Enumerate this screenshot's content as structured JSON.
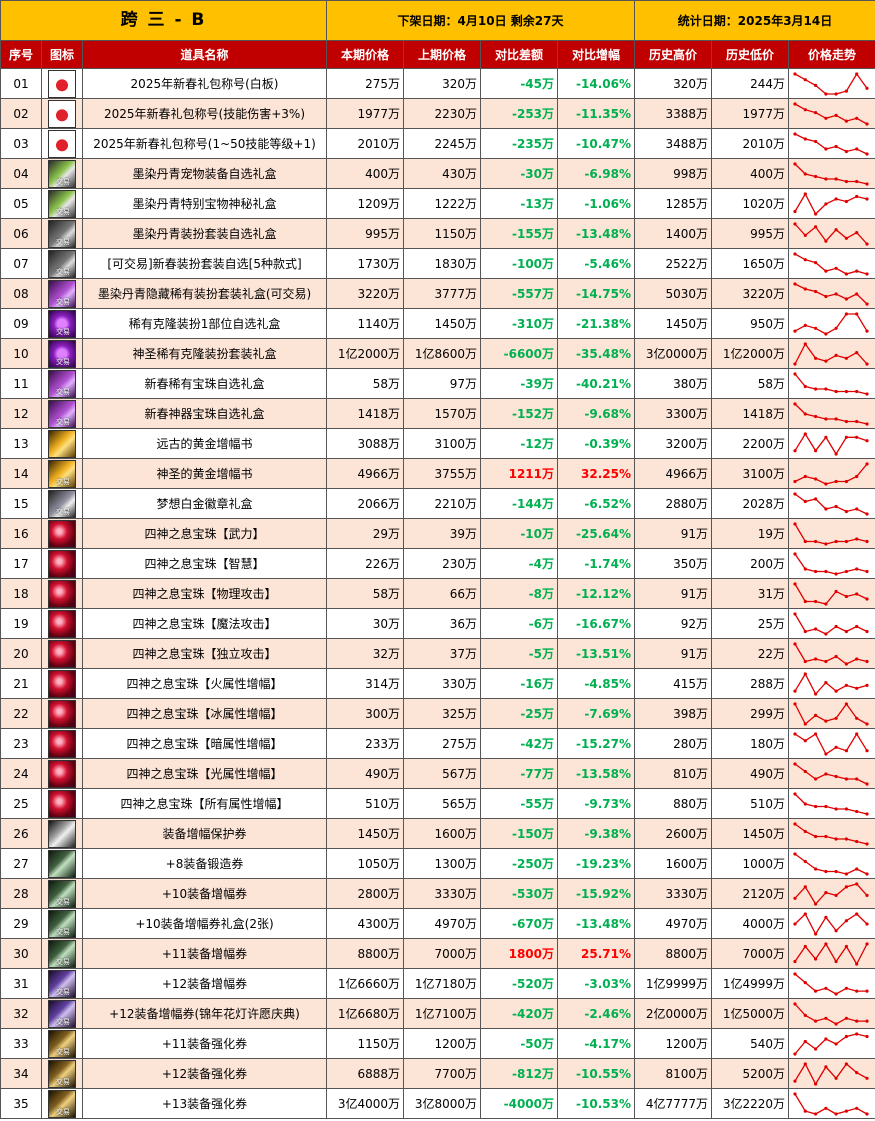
{
  "title": {
    "server": "跨 三 - B",
    "removal": "下架日期：4月10日  剩余27天",
    "stat_date": "统计日期：2025年3月14日"
  },
  "headers": [
    "序号",
    "图标",
    "道具名称",
    "本期价格",
    "上期价格",
    "对比差额",
    "对比增幅",
    "历史高价",
    "历史低价",
    "价格走势"
  ],
  "colors": {
    "header_bg": "#c00000",
    "title_bg": "#ffc000",
    "alt_row": "#fce4d6",
    "decrease": "#00b050",
    "increase": "#ff0000",
    "trend_line": "#e00000"
  },
  "rows": [
    {
      "idx": "01",
      "icon": "red-envelope-icon",
      "trade": "",
      "name": "2025年新春礼包称号(白板)",
      "cur": "275万",
      "prev": "320万",
      "diff": "-45万",
      "pct": "-14.06%",
      "high": "320万",
      "low": "244万",
      "trend": [
        9,
        7,
        5,
        2,
        2,
        3,
        9,
        4
      ],
      "up": false
    },
    {
      "idx": "02",
      "icon": "red-envelope-icon",
      "trade": "",
      "name": "2025年新春礼包称号(技能伤害+3%)",
      "cur": "1977万",
      "prev": "2230万",
      "diff": "-253万",
      "pct": "-11.35%",
      "high": "3388万",
      "low": "1977万",
      "trend": [
        9,
        7,
        6,
        4,
        5,
        3,
        4,
        2
      ],
      "up": false
    },
    {
      "idx": "03",
      "icon": "red-envelope-icon",
      "trade": "",
      "name": "2025年新春礼包称号(1~50技能等级+1)",
      "cur": "2010万",
      "prev": "2245万",
      "diff": "-235万",
      "pct": "-10.47%",
      "high": "3488万",
      "low": "2010万",
      "trend": [
        9,
        7,
        6,
        3,
        4,
        2,
        3,
        1
      ],
      "up": false
    },
    {
      "idx": "04",
      "icon": "gift-box-green-icon",
      "trade": "交易",
      "name": "墨染丹青宠物装备自选礼盒",
      "cur": "400万",
      "prev": "430万",
      "diff": "-30万",
      "pct": "-6.98%",
      "high": "998万",
      "low": "400万",
      "trend": [
        9,
        5,
        4,
        3,
        3,
        2,
        2,
        1
      ],
      "up": false
    },
    {
      "idx": "05",
      "icon": "gift-box-green-icon",
      "trade": "交易",
      "name": "墨染丹青特别宝物神秘礼盒",
      "cur": "1209万",
      "prev": "1222万",
      "diff": "-13万",
      "pct": "-1.06%",
      "high": "1285万",
      "low": "1020万",
      "trend": [
        2,
        9,
        1,
        5,
        7,
        6,
        8,
        7
      ],
      "up": false
    },
    {
      "idx": "06",
      "icon": "gift-box-dark-icon",
      "trade": "交易",
      "name": "墨染丹青装扮套装自选礼盒",
      "cur": "995万",
      "prev": "1150万",
      "diff": "-155万",
      "pct": "-13.48%",
      "high": "1400万",
      "low": "995万",
      "trend": [
        9,
        5,
        8,
        3,
        7,
        4,
        6,
        2
      ],
      "up": false
    },
    {
      "idx": "07",
      "icon": "gift-box-dark-icon",
      "trade": "交易",
      "name": "[可交易]新春装扮套装自选[5种款式]",
      "cur": "1730万",
      "prev": "1830万",
      "diff": "-100万",
      "pct": "-5.46%",
      "high": "2522万",
      "low": "1650万",
      "trend": [
        9,
        7,
        6,
        3,
        4,
        2,
        3,
        2
      ],
      "up": false
    },
    {
      "idx": "08",
      "icon": "gift-box-purple-icon",
      "trade": "交易",
      "name": "墨染丹青隐藏稀有装扮套装礼盒(可交易)",
      "cur": "3220万",
      "prev": "3777万",
      "diff": "-557万",
      "pct": "-14.75%",
      "high": "5030万",
      "low": "3220万",
      "trend": [
        9,
        7,
        6,
        4,
        5,
        3,
        5,
        1
      ],
      "up": false
    },
    {
      "idx": "09",
      "icon": "orb-purple-icon",
      "trade": "交易",
      "name": "稀有克隆装扮1部位自选礼盒",
      "cur": "1140万",
      "prev": "1450万",
      "diff": "-310万",
      "pct": "-21.38%",
      "high": "1450万",
      "low": "950万",
      "trend": [
        3,
        5,
        4,
        2,
        4,
        9,
        9,
        3
      ],
      "up": false
    },
    {
      "idx": "10",
      "icon": "orb-purple-icon",
      "trade": "交易",
      "name": "神圣稀有克隆装扮套装礼盒",
      "cur": "1亿2000万",
      "prev": "1亿8600万",
      "diff": "-6600万",
      "pct": "-35.48%",
      "high": "3亿0000万",
      "low": "1亿2000万",
      "trend": [
        2,
        9,
        4,
        3,
        5,
        4,
        6,
        2
      ],
      "up": false
    },
    {
      "idx": "11",
      "icon": "gift-box-purple-icon",
      "trade": "交易",
      "name": "新春稀有宝珠自选礼盒",
      "cur": "58万",
      "prev": "97万",
      "diff": "-39万",
      "pct": "-40.21%",
      "high": "380万",
      "low": "58万",
      "trend": [
        9,
        4,
        3,
        3,
        2,
        2,
        2,
        1
      ],
      "up": false
    },
    {
      "idx": "12",
      "icon": "gift-box-purple-icon",
      "trade": "交易",
      "name": "新春神器宝珠自选礼盒",
      "cur": "1418万",
      "prev": "1570万",
      "diff": "-152万",
      "pct": "-9.68%",
      "high": "3300万",
      "low": "1418万",
      "trend": [
        9,
        5,
        4,
        3,
        3,
        2,
        2,
        1
      ],
      "up": false
    },
    {
      "idx": "13",
      "icon": "gold-book-icon",
      "trade": "",
      "name": "远古的黄金增幅书",
      "cur": "3088万",
      "prev": "3100万",
      "diff": "-12万",
      "pct": "-0.39%",
      "high": "3200万",
      "low": "2200万",
      "trend": [
        4,
        9,
        4,
        8,
        3,
        8,
        8,
        7
      ],
      "up": false
    },
    {
      "idx": "14",
      "icon": "gold-book-icon",
      "trade": "交易",
      "name": "神圣的黄金增幅书",
      "cur": "4966万",
      "prev": "3755万",
      "diff": "1211万",
      "pct": "32.25%",
      "high": "4966万",
      "low": "3100万",
      "trend": [
        2,
        4,
        3,
        1,
        2,
        2,
        4,
        9
      ],
      "up": true
    },
    {
      "idx": "15",
      "icon": "badge-icon",
      "trade": "交易",
      "name": "梦想白金徽章礼盒",
      "cur": "2066万",
      "prev": "2210万",
      "diff": "-144万",
      "pct": "-6.52%",
      "high": "2880万",
      "low": "2028万",
      "trend": [
        9,
        6,
        7,
        3,
        4,
        2,
        3,
        1
      ],
      "up": false
    },
    {
      "idx": "16",
      "icon": "red-gem-icon",
      "trade": "",
      "name": "四神之息宝珠【武力】",
      "cur": "29万",
      "prev": "39万",
      "diff": "-10万",
      "pct": "-25.64%",
      "high": "91万",
      "low": "19万",
      "trend": [
        9,
        2,
        2,
        1,
        2,
        2,
        3,
        2
      ],
      "up": false
    },
    {
      "idx": "17",
      "icon": "red-gem-icon",
      "trade": "",
      "name": "四神之息宝珠【智慧】",
      "cur": "226万",
      "prev": "230万",
      "diff": "-4万",
      "pct": "-1.74%",
      "high": "350万",
      "low": "200万",
      "trend": [
        9,
        3,
        2,
        2,
        1,
        2,
        3,
        2
      ],
      "up": false
    },
    {
      "idx": "18",
      "icon": "red-gem-icon",
      "trade": "",
      "name": "四神之息宝珠【物理攻击】",
      "cur": "58万",
      "prev": "66万",
      "diff": "-8万",
      "pct": "-12.12%",
      "high": "91万",
      "low": "31万",
      "trend": [
        9,
        2,
        2,
        1,
        6,
        4,
        5,
        3
      ],
      "up": false
    },
    {
      "idx": "19",
      "icon": "red-gem-icon",
      "trade": "",
      "name": "四神之息宝珠【魔法攻击】",
      "cur": "30万",
      "prev": "36万",
      "diff": "-6万",
      "pct": "-16.67%",
      "high": "92万",
      "low": "25万",
      "trend": [
        9,
        2,
        3,
        1,
        4,
        2,
        4,
        2
      ],
      "up": false
    },
    {
      "idx": "20",
      "icon": "red-gem-icon",
      "trade": "",
      "name": "四神之息宝珠【独立攻击】",
      "cur": "32万",
      "prev": "37万",
      "diff": "-5万",
      "pct": "-13.51%",
      "high": "91万",
      "low": "22万",
      "trend": [
        9,
        2,
        3,
        2,
        4,
        1,
        3,
        2
      ],
      "up": false
    },
    {
      "idx": "21",
      "icon": "red-gem-icon",
      "trade": "",
      "name": "四神之息宝珠【火属性增幅】",
      "cur": "314万",
      "prev": "330万",
      "diff": "-16万",
      "pct": "-4.85%",
      "high": "415万",
      "low": "288万",
      "trend": [
        3,
        9,
        2,
        6,
        3,
        5,
        4,
        5
      ],
      "up": false
    },
    {
      "idx": "22",
      "icon": "red-gem-icon",
      "trade": "",
      "name": "四神之息宝珠【冰属性增幅】",
      "cur": "300万",
      "prev": "325万",
      "diff": "-25万",
      "pct": "-7.69%",
      "high": "398万",
      "low": "299万",
      "trend": [
        9,
        2,
        5,
        3,
        4,
        9,
        4,
        2
      ],
      "up": false
    },
    {
      "idx": "23",
      "icon": "red-gem-icon",
      "trade": "",
      "name": "四神之息宝珠【暗属性增幅】",
      "cur": "233万",
      "prev": "275万",
      "diff": "-42万",
      "pct": "-15.27%",
      "high": "280万",
      "low": "180万",
      "trend": [
        9,
        7,
        9,
        3,
        5,
        4,
        9,
        4
      ],
      "up": false
    },
    {
      "idx": "24",
      "icon": "red-gem-icon",
      "trade": "",
      "name": "四神之息宝珠【光属性增幅】",
      "cur": "490万",
      "prev": "567万",
      "diff": "-77万",
      "pct": "-13.58%",
      "high": "810万",
      "low": "490万",
      "trend": [
        9,
        6,
        3,
        5,
        4,
        3,
        3,
        1
      ],
      "up": false
    },
    {
      "idx": "25",
      "icon": "red-gem-icon",
      "trade": "",
      "name": "四神之息宝珠【所有属性增幅】",
      "cur": "510万",
      "prev": "565万",
      "diff": "-55万",
      "pct": "-9.73%",
      "high": "880万",
      "low": "510万",
      "trend": [
        9,
        5,
        4,
        4,
        3,
        3,
        2,
        1
      ],
      "up": false
    },
    {
      "idx": "26",
      "icon": "ticket-icon",
      "trade": "",
      "name": "装备增幅保护券",
      "cur": "1450万",
      "prev": "1600万",
      "diff": "-150万",
      "pct": "-9.38%",
      "high": "2600万",
      "low": "1450万",
      "trend": [
        9,
        6,
        4,
        4,
        3,
        3,
        2,
        1
      ],
      "up": false
    },
    {
      "idx": "27",
      "icon": "ticket-plus-icon",
      "trade": "",
      "name": "+8装备锻造券",
      "cur": "1050万",
      "prev": "1300万",
      "diff": "-250万",
      "pct": "-19.23%",
      "high": "1600万",
      "low": "1000万",
      "trend": [
        9,
        6,
        3,
        2,
        2,
        1,
        3,
        1
      ],
      "up": false
    },
    {
      "idx": "28",
      "icon": "ticket-plus-icon",
      "trade": "交易",
      "name": "+10装备增幅券",
      "cur": "2800万",
      "prev": "3330万",
      "diff": "-530万",
      "pct": "-15.92%",
      "high": "3330万",
      "low": "2120万",
      "trend": [
        4,
        8,
        2,
        6,
        5,
        8,
        9,
        5
      ],
      "up": false
    },
    {
      "idx": "29",
      "icon": "ticket-plus-icon",
      "trade": "交易",
      "name": "+10装备增幅券礼盒(2张)",
      "cur": "4300万",
      "prev": "4970万",
      "diff": "-670万",
      "pct": "-13.48%",
      "high": "4970万",
      "low": "4000万",
      "trend": [
        6,
        9,
        3,
        8,
        4,
        7,
        9,
        6
      ],
      "up": false
    },
    {
      "idx": "30",
      "icon": "ticket-plus-icon",
      "trade": "交易",
      "name": "+11装备增幅券",
      "cur": "8800万",
      "prev": "7000万",
      "diff": "1800万",
      "pct": "25.71%",
      "high": "8800万",
      "low": "7000万",
      "trend": [
        2,
        8,
        3,
        9,
        2,
        8,
        1,
        9
      ],
      "up": true
    },
    {
      "idx": "31",
      "icon": "ticket-plus-purple-icon",
      "trade": "交易",
      "name": "+12装备增幅券",
      "cur": "1亿6660万",
      "prev": "1亿7180万",
      "diff": "-520万",
      "pct": "-3.03%",
      "high": "1亿9999万",
      "low": "1亿4999万",
      "trend": [
        9,
        6,
        3,
        4,
        2,
        4,
        3,
        3
      ],
      "up": false
    },
    {
      "idx": "32",
      "icon": "ticket-plus-purple-icon",
      "trade": "交易",
      "name": "+12装备增幅券(锦年花灯许愿庆典)",
      "cur": "1亿6680万",
      "prev": "1亿7100万",
      "diff": "-420万",
      "pct": "-2.46%",
      "high": "2亿0000万",
      "low": "1亿5000万",
      "trend": [
        9,
        5,
        3,
        4,
        2,
        4,
        3,
        3
      ],
      "up": false
    },
    {
      "idx": "33",
      "icon": "ticket-plus-gold-icon",
      "trade": "交易",
      "name": "+11装备强化券",
      "cur": "1150万",
      "prev": "1200万",
      "diff": "-50万",
      "pct": "-4.17%",
      "high": "1200万",
      "low": "540万",
      "trend": [
        1,
        6,
        3,
        7,
        5,
        8,
        9,
        8
      ],
      "up": false
    },
    {
      "idx": "34",
      "icon": "ticket-plus-gold-icon",
      "trade": "交易",
      "name": "+12装备强化券",
      "cur": "6888万",
      "prev": "7700万",
      "diff": "-812万",
      "pct": "-10.55%",
      "high": "8100万",
      "low": "5200万",
      "trend": [
        3,
        9,
        2,
        8,
        4,
        9,
        6,
        4
      ],
      "up": false
    },
    {
      "idx": "35",
      "icon": "ticket-plus-gold-icon",
      "trade": "交易",
      "name": "+13装备强化券",
      "cur": "3亿4000万",
      "prev": "3亿8000万",
      "diff": "-4000万",
      "pct": "-10.53%",
      "high": "4亿7777万",
      "low": "3亿2220万",
      "trend": [
        9,
        3,
        2,
        4,
        2,
        3,
        4,
        2
      ],
      "up": false
    }
  ]
}
